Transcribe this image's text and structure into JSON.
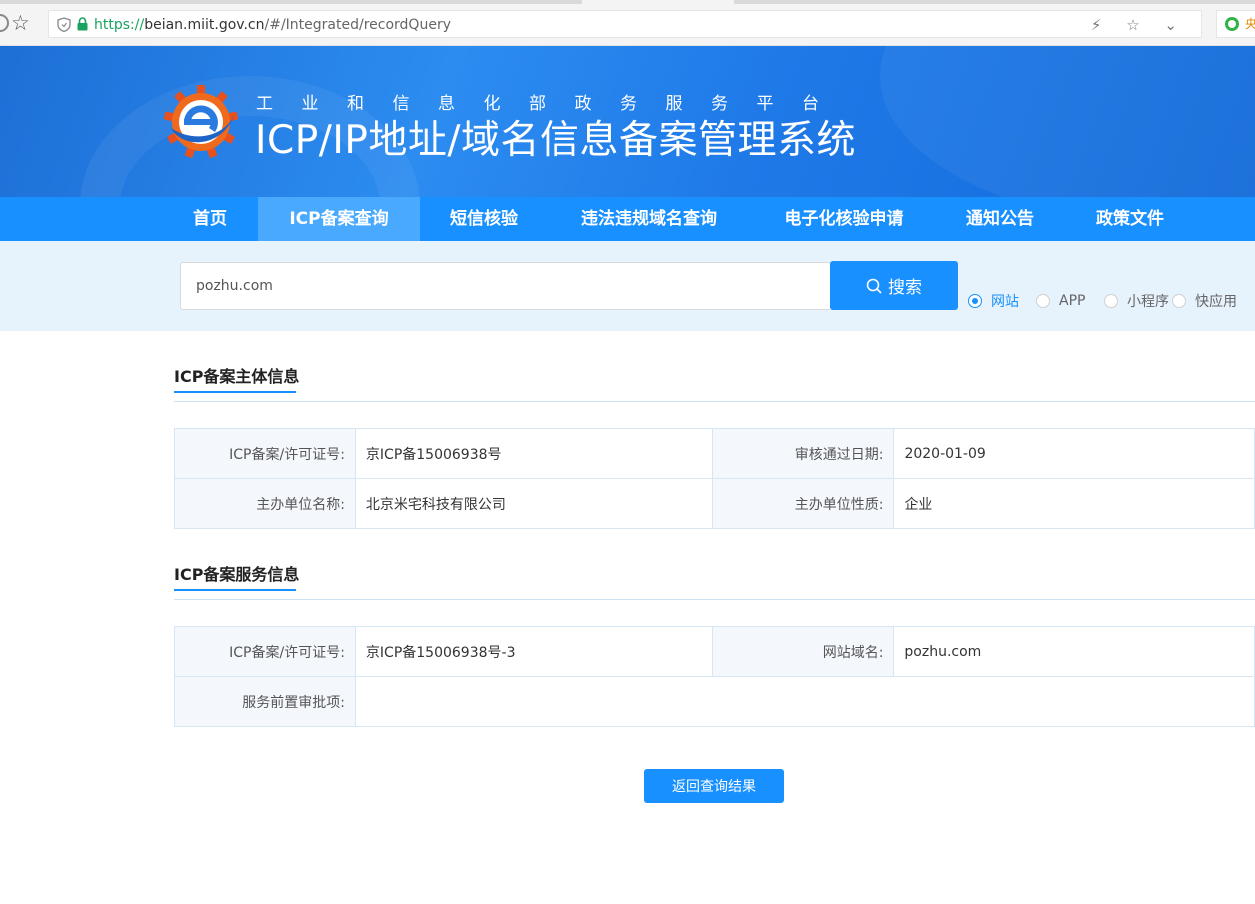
{
  "browser": {
    "url_scheme": "https://",
    "url_host": "beian.miit.gov.cn",
    "url_path": "/#/Integrated/recordQuery",
    "extension_text": "央",
    "toolbar_icons": "⚡ ☆ ⌄"
  },
  "header": {
    "subtitle": "工业和信息化部政务服务平台",
    "title": "ICP/IP地址/域名信息备案管理系统"
  },
  "nav": {
    "items": [
      {
        "label": "首页"
      },
      {
        "label": "ICP备案查询",
        "active": true
      },
      {
        "label": "短信核验"
      },
      {
        "label": "违法违规域名查询"
      },
      {
        "label": "电子化核验申请"
      },
      {
        "label": "通知公告"
      },
      {
        "label": "政策文件"
      }
    ]
  },
  "search": {
    "query": "pozhu.com",
    "button_label": "搜索",
    "types": [
      {
        "label": "网站",
        "checked": true
      },
      {
        "label": "APP",
        "checked": false
      },
      {
        "label": "小程序",
        "checked": false
      },
      {
        "label": "快应用",
        "checked": false
      }
    ]
  },
  "subject_info": {
    "section_title": "ICP备案主体信息",
    "rows": [
      [
        {
          "label": "ICP备案/许可证号:",
          "value": "京ICP备15006938号"
        },
        {
          "label": "审核通过日期:",
          "value": "2020-01-09"
        }
      ],
      [
        {
          "label": "主办单位名称:",
          "value": "北京米宅科技有限公司"
        },
        {
          "label": "主办单位性质:",
          "value": "企业"
        }
      ]
    ]
  },
  "service_info": {
    "section_title": "ICP备案服务信息",
    "rows": [
      [
        {
          "label": "ICP备案/许可证号:",
          "value": "京ICP备15006938号-3"
        },
        {
          "label": "网站域名:",
          "value": "pozhu.com"
        }
      ],
      [
        {
          "label": "服务前置审批项:",
          "value": ""
        }
      ]
    ]
  },
  "actions": {
    "back_label": "返回查询结果"
  },
  "colors": {
    "primary": "#1890ff",
    "nav_active": "#49a9ff",
    "search_band": "#e6f2fc"
  }
}
